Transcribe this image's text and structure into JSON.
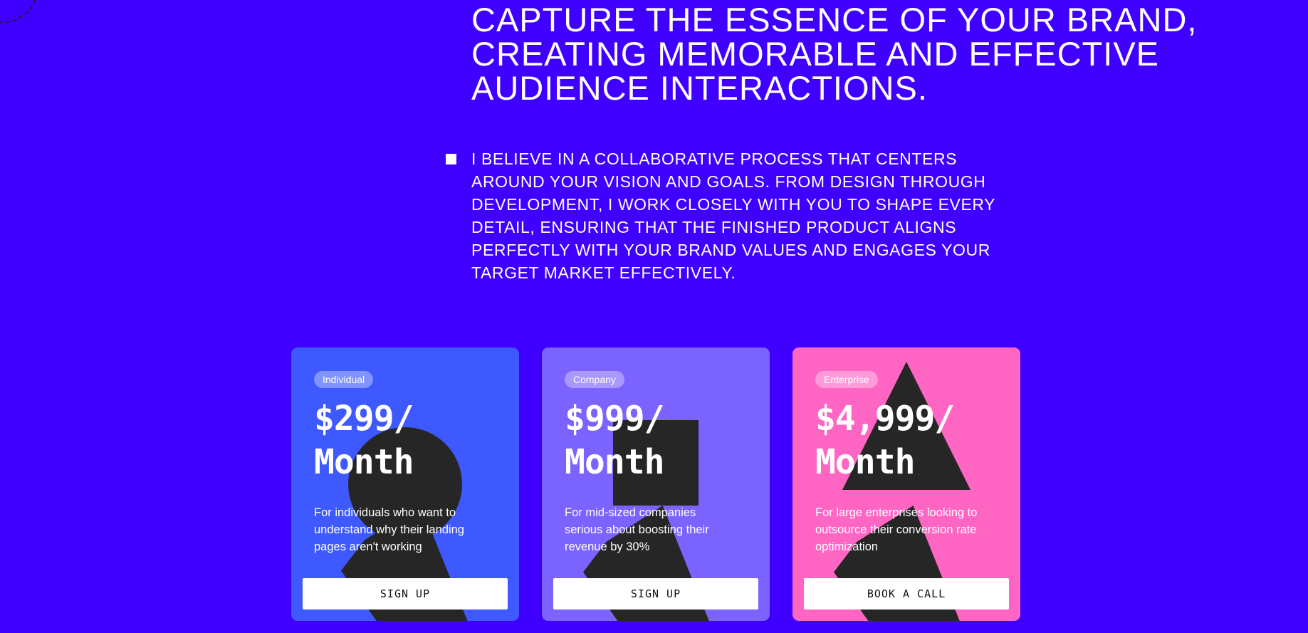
{
  "hero": {
    "headline_lines": [
      "CAPTURE THE ESSENCE OF YOUR BRAND,",
      "CREATING MEMORABLE AND EFFECTIVE",
      "AUDIENCE INTERACTIONS."
    ],
    "body_lines": [
      "I BELIEVE IN A COLLABORATIVE PROCESS THAT CENTERS",
      "AROUND YOUR VISION AND GOALS. FROM DESIGN THROUGH",
      "DEVELOPMENT, I WORK CLOSELY WITH YOU TO SHAPE EVERY",
      "DETAIL, ENSURING THAT THE FINISHED PRODUCT ALIGNS",
      "PERFECTLY WITH YOUR BRAND VALUES AND ENGAGES YOUR",
      "TARGET MARKET EFFECTIVELY."
    ]
  },
  "pricing": [
    {
      "tag": "Individual",
      "price_lines": [
        "$299/",
        "Month"
      ],
      "desc_lines": [
        "For individuals who want to",
        "understand why their landing",
        "pages aren't working"
      ],
      "cta": "SIGN UP",
      "color": "#3d59ff"
    },
    {
      "tag": "Company",
      "price_lines": [
        "$999/",
        "Month"
      ],
      "desc_lines": [
        "For mid-sized companies",
        "serious about boosting their",
        "revenue by 30%"
      ],
      "cta": "SIGN UP",
      "color": "#7b63ff"
    },
    {
      "tag": "Enterprise",
      "price_lines": [
        "$4,999/",
        "Month"
      ],
      "desc_lines": [
        "For large enterprises looking to",
        "outsource their conversion rate",
        "optimization"
      ],
      "cta": "BOOK A CALL",
      "color": "#ff66c4"
    }
  ],
  "colors": {
    "background": "#4000ff",
    "shape": "#262626"
  }
}
